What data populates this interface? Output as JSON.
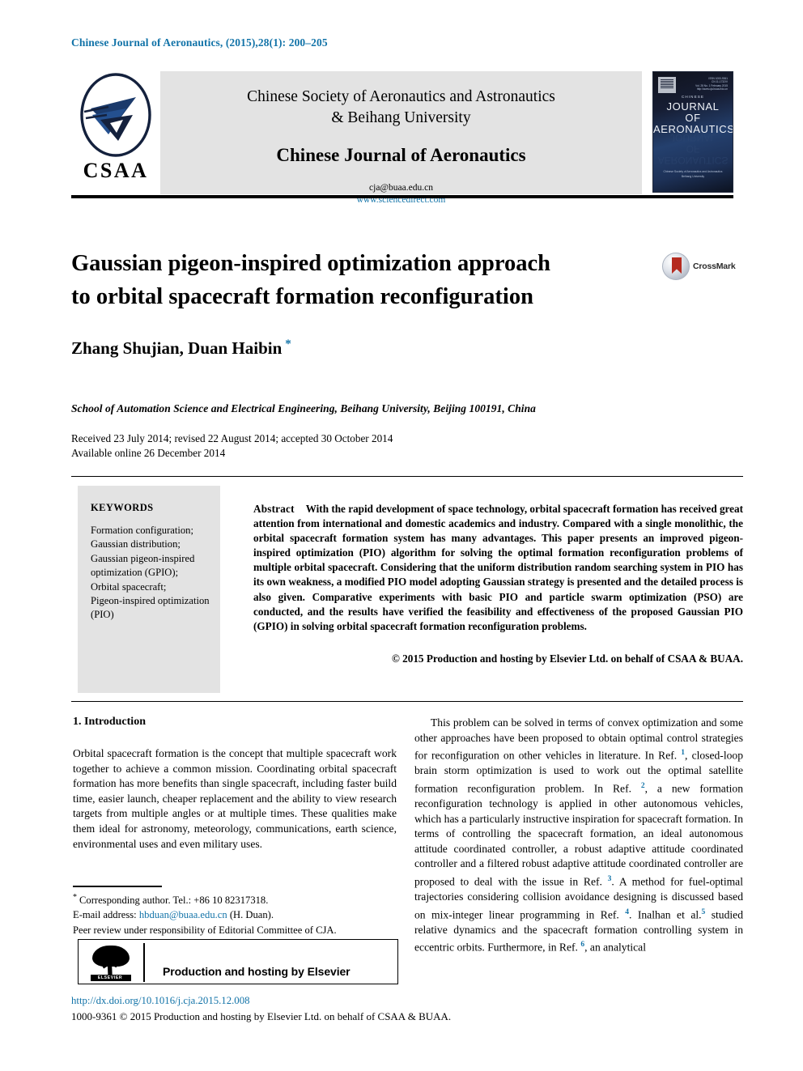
{
  "running_head": "Chinese Journal of Aeronautics, (2015),28(1): 200–205",
  "masthead": {
    "logo_text": "CSAA",
    "society_line1": "Chinese Society of Aeronautics and Astronautics",
    "society_line2": "& Beihang University",
    "journal_name": "Chinese Journal of Aeronautics",
    "email": "cja@buaa.edu.cn",
    "url": "www.sciencedirect.com",
    "cover": {
      "issn_block": "ISSN 1000-9361\nCN 11-1732/V\nVol. 28 No. 1  February 2015\nhttp://www.cja.buaa.edu.cn",
      "chinese_label": "CHINESE",
      "title_line1": "JOURNAL",
      "title_line2": "OF",
      "title_line3": "AERONAUTICS",
      "footer_line1": "Chinese Society of Aeronautics and Astronautics",
      "footer_line2": "Beihang University"
    }
  },
  "article": {
    "title_line1": "Gaussian pigeon-inspired optimization approach",
    "title_line2": "to orbital spacecraft formation reconfiguration",
    "crossmark_label": "CrossMark",
    "authors": "Zhang Shujian, Duan Haibin",
    "corresponding_marker": "*",
    "affiliation": "School of Automation Science and Electrical Engineering, Beihang University, Beijing 100191, China",
    "history_line1": "Received 23 July 2014; revised 22 August 2014; accepted 30 October 2014",
    "history_line2": "Available online 26 December 2014"
  },
  "keywords": {
    "heading": "KEYWORDS",
    "items": "Formation configuration;\nGaussian distribution;\nGaussian pigeon-inspired\noptimization (GPIO);\nOrbital spacecraft;\nPigeon-inspired optimization\n(PIO)"
  },
  "abstract": {
    "label": "Abstract",
    "text": "With the rapid development of space technology, orbital spacecraft formation has received great attention from international and domestic academics and industry. Compared with a single monolithic, the orbital spacecraft formation system has many advantages. This paper presents an improved pigeon-inspired optimization (PIO) algorithm for solving the optimal formation reconfiguration problems of multiple orbital spacecraft. Considering that the uniform distribution random searching system in PIO has its own weakness, a modified PIO model adopting Gaussian strategy is presented and the detailed process is also given. Comparative experiments with basic PIO and particle swarm optimization (PSO) are conducted, and the results have verified the feasibility and effectiveness of the proposed Gaussian PIO (GPIO) in solving orbital spacecraft formation reconfiguration problems.",
    "copyright": "© 2015 Production and hosting by Elsevier Ltd. on behalf of CSAA & BUAA."
  },
  "body": {
    "section_heading": "1. Introduction",
    "left_paragraph": "Orbital spacecraft formation is the concept that multiple spacecraft work together to achieve a common mission. Coordinating orbital spacecraft formation has more benefits than single spacecraft, including faster build time, easier launch, cheaper replacement and the ability to view research targets from multiple angles or at multiple times. These qualities make them ideal for astronomy, meteorology, communications, earth science, environmental uses and even military uses.",
    "right_paragraph_parts": {
      "p1": "This problem can be solved in terms of convex optimization and some other approaches have been proposed to obtain optimal control strategies for reconfiguration on other vehicles in literature. In Ref. ",
      "ref1": "1",
      "p2": ", closed-loop brain storm optimization is used to work out the optimal satellite formation reconfiguration problem. In Ref. ",
      "ref2": "2",
      "p3": ", a new formation reconfiguration technology is applied in other autonomous vehicles, which has a particularly instructive inspiration for spacecraft formation. In terms of controlling the spacecraft formation, an ideal autonomous attitude coordinated controller, a robust adaptive attitude coordinated controller and a filtered robust adaptive attitude coordinated controller are proposed to deal with the issue in Ref. ",
      "ref3": "3",
      "p4": ". A method for fuel-optimal trajectories considering collision avoidance designing is discussed based on mix-integer linear programming in Ref. ",
      "ref4": "4",
      "p5": ". Inalhan et al.",
      "ref5": "5",
      "p6": " studied relative dynamics and the spacecraft formation controlling system in eccentric orbits. Furthermore, in Ref. ",
      "ref6": "6",
      "p7": ", an analytical"
    }
  },
  "footnotes": {
    "corresponding_marker": "*",
    "corresponding": "Corresponding author. Tel.: +86 10 82317318.",
    "email_label": "E-mail address:",
    "email": "hbduan@buaa.edu.cn",
    "email_suffix": "(H. Duan).",
    "peer_review": "Peer review under responsibility of Editorial Committee of CJA.",
    "elsevier_banner": "Production and hosting by Elsevier",
    "elsevier_logo_word": "ELSEVIER"
  },
  "footer": {
    "doi": "http://dx.doi.org/10.1016/j.cja.2015.12.008",
    "issn_line": "1000-9361 © 2015 Production and hosting by Elsevier Ltd. on behalf of CSAA & BUAA."
  },
  "colors": {
    "link_blue": "#1273a8",
    "panel_gray": "#e3e3e3",
    "crossmark_red": "#b52b20"
  }
}
